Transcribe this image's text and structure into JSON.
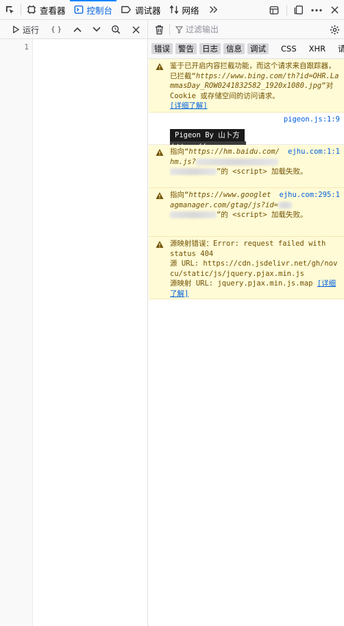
{
  "tabs": {
    "inspector": "查看器",
    "console": "控制台",
    "debugger": "调试器",
    "network": "网络"
  },
  "editor_toolbar": {
    "run_label": "运行",
    "pretty_label": "{ }"
  },
  "editor": {
    "line_number": "1"
  },
  "console_toolbar": {
    "filter_placeholder": "过滤输出"
  },
  "filters": {
    "errors": "错误",
    "warnings": "警告",
    "logs": "日志",
    "info": "信息",
    "debug": "调试",
    "css": "CSS",
    "xhr": "XHR",
    "requests": "请求"
  },
  "messages": {
    "m1": {
      "text_a": "鉴于已开启内容拦截功能，而这个请求来自跟踪器，已拦截“",
      "url": "https://www.bing.com/th?id=OHR.LammasDay_ROW0241832582_1920x1080.jpg",
      "text_b": "”对 Cookie 或存储空间的访问请求。",
      "learn_more": "[详细了解]"
    },
    "m2": {
      "source": "pigeon.js:1:9",
      "box_text": "Pigeon By 山卜方",
      "box_url": "https://novcu.com"
    },
    "m3": {
      "source": "ejhu.com:1:1",
      "text_a": "指向“",
      "url": "https://hm.baidu.com/hm.js?",
      "text_b": "”的 <script> 加载失败。"
    },
    "m4": {
      "source": "ejhu.com:295:1",
      "text_a": "指向“",
      "url": "https://www.googletagmanager.com/gtag/js?id=",
      "text_b": "”的 <script> 加载失败。"
    },
    "m5": {
      "line1": "源映射错误：Error: request failed with status 404",
      "line2": "源 URL: https://cdn.jsdelivr.net/gh/novcu/static/js/jquery.pjax.min.js",
      "line3": "源映射 URL: jquery.pjax.min.js.map",
      "learn_more": "[详细了解]"
    }
  }
}
